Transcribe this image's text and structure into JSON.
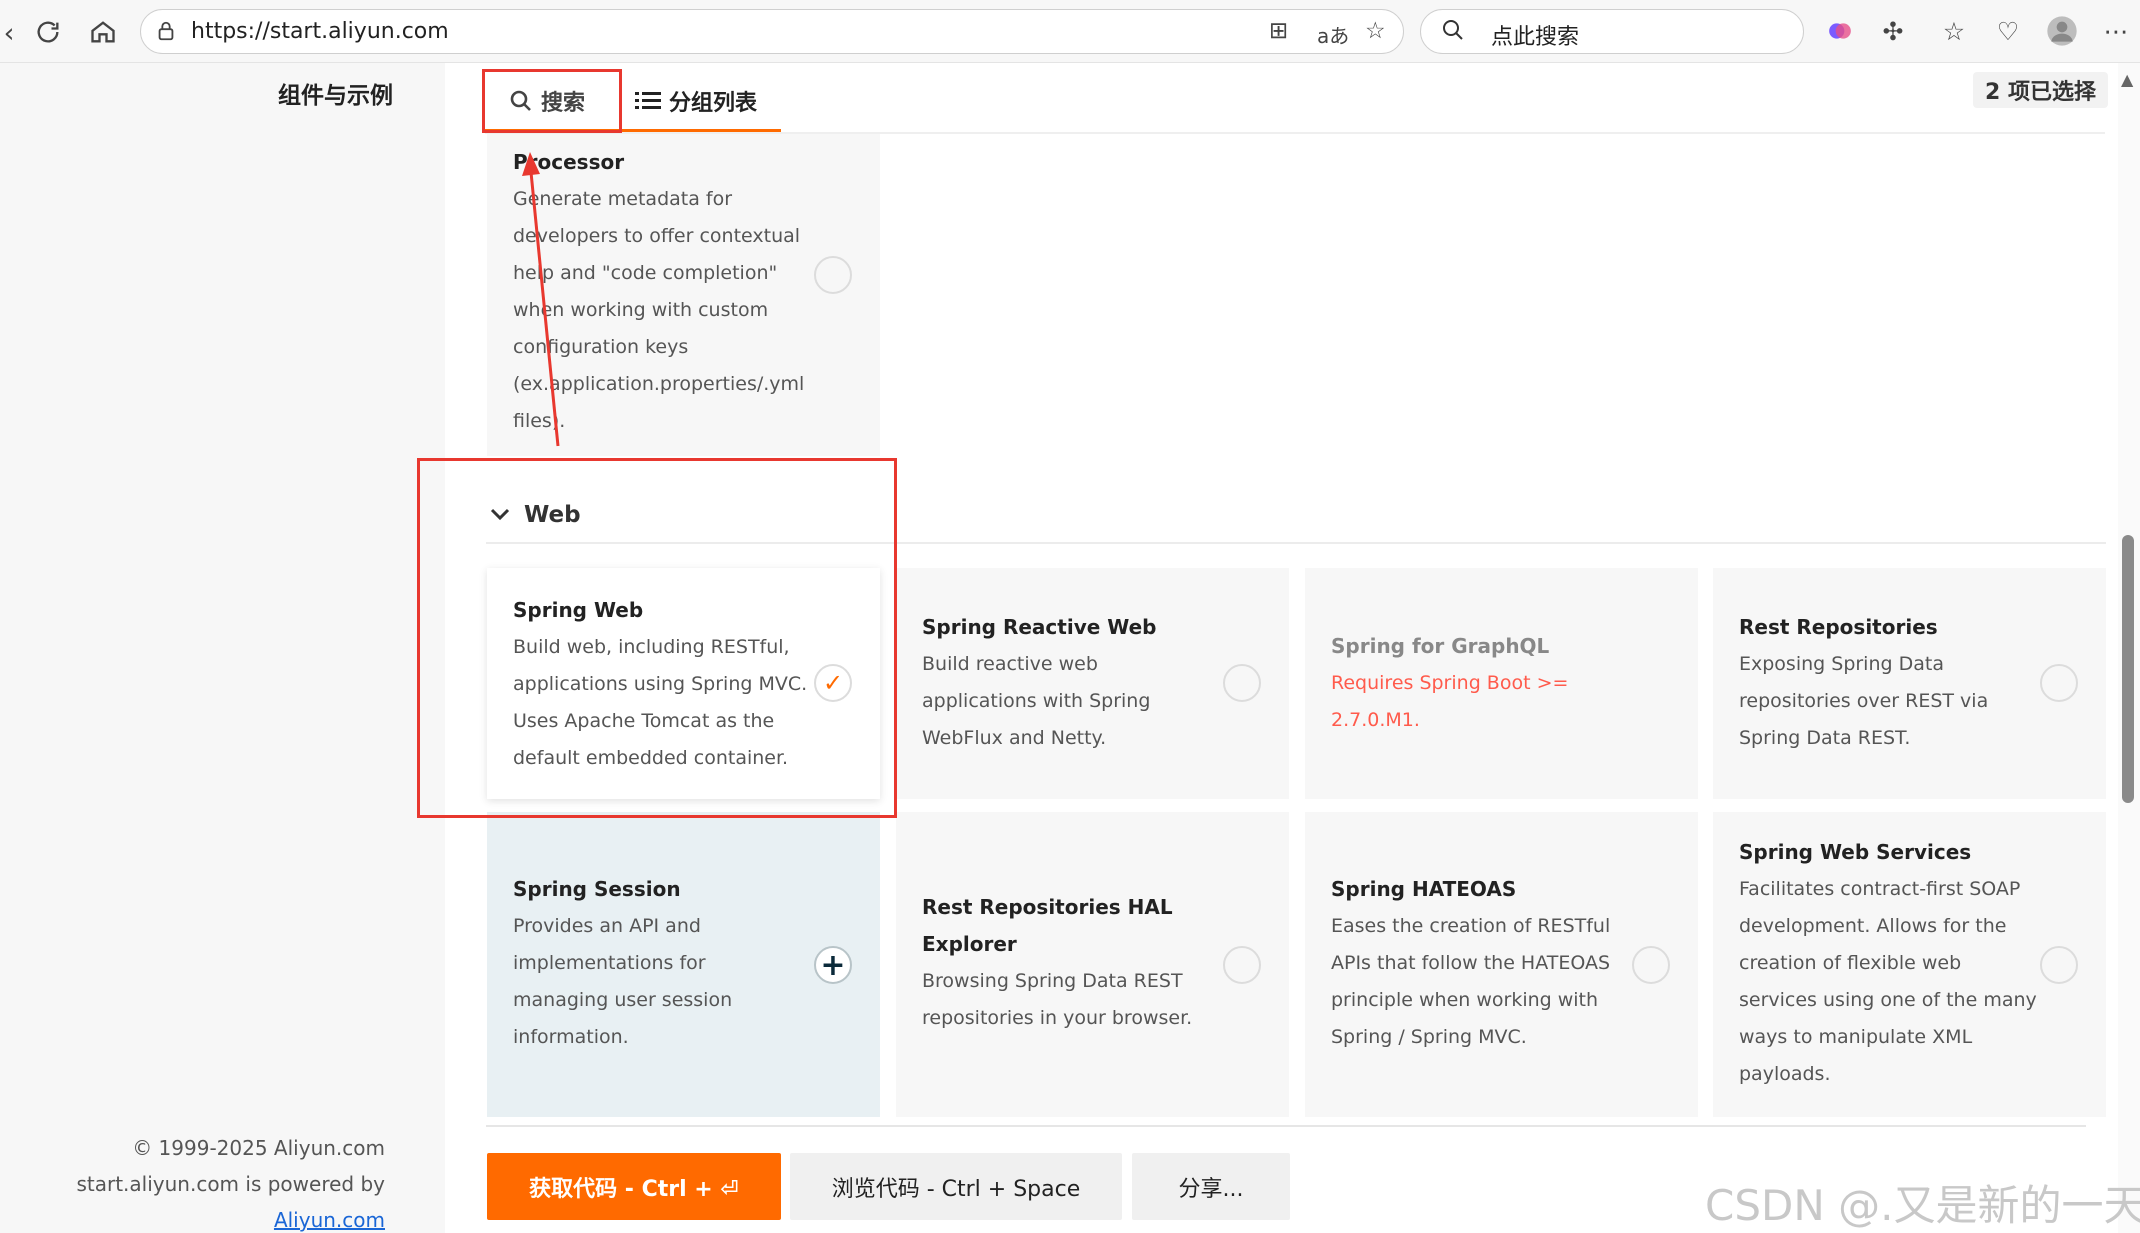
{
  "browser": {
    "url": "https://start.aliyun.com",
    "search_placeholder": "点此搜索",
    "icons": [
      "back-icon",
      "reload-icon",
      "home-icon",
      "lock-icon",
      "grid-icon",
      "translate-icon",
      "star-icon",
      "search-icon",
      "copilot-icon",
      "extensions-icon",
      "favorites-icon",
      "health-icon",
      "avatar-icon",
      "more-icon"
    ]
  },
  "sidebar": {
    "title": "组件与示例",
    "footer_copyright": "© 1999-2025 Aliyun.com",
    "footer_powered": "start.aliyun.com is powered by",
    "footer_link": "Aliyun.com"
  },
  "tabs": {
    "search_label": "搜索",
    "list_label": "分组列表"
  },
  "selected_count": "2 项已选择",
  "prev_card": {
    "title_tail": "Processor",
    "description_lines": [
      "Generate metadata for",
      "developers to offer contextual",
      "help and \"code completion\"",
      "when working with custom",
      "configuration keys",
      "(ex.application.properties/.yml",
      "files)."
    ]
  },
  "section": {
    "name": "Web",
    "chevron_icon": "chevron-down-icon"
  },
  "cards": [
    {
      "title_lines": [
        "Spring Web"
      ],
      "desc_lines": [
        "Build web, including RESTful,",
        "applications using Spring MVC.",
        "Uses Apache Tomcat as the",
        "default embedded container."
      ],
      "state": "selected"
    },
    {
      "title_lines": [
        "Spring Reactive Web"
      ],
      "desc_lines": [
        "Build reactive web",
        "applications with Spring",
        "WebFlux and Netty."
      ],
      "state": "unselected"
    },
    {
      "title_lines": [
        "Spring for GraphQL"
      ],
      "warn_lines": [
        "Requires Spring Boot >=",
        "2.7.0.M1."
      ],
      "state": "disabled"
    },
    {
      "title_lines": [
        "Rest Repositories"
      ],
      "desc_lines": [
        "Exposing Spring Data",
        "repositories over REST via",
        "Spring Data REST."
      ],
      "state": "unselected"
    },
    {
      "title_lines": [
        "Spring Session"
      ],
      "desc_lines": [
        "Provides an API and",
        "implementations for",
        "managing user session",
        "information."
      ],
      "state": "hover"
    },
    {
      "title_lines": [
        "Rest Repositories HAL",
        "Explorer"
      ],
      "desc_lines": [
        "Browsing Spring Data REST",
        "repositories in your browser."
      ],
      "state": "unselected"
    },
    {
      "title_lines": [
        "Spring HATEOAS"
      ],
      "desc_lines": [
        "Eases the creation of RESTful",
        "APIs that follow the HATEOAS",
        "principle when working with",
        "Spring / Spring MVC."
      ],
      "state": "unselected"
    },
    {
      "title_lines": [
        "Spring Web Services"
      ],
      "desc_lines": [
        "Facilitates contract-first SOAP",
        "development. Allows for the",
        "creation of flexible web",
        "services using one of the many",
        "ways to manipulate XML",
        "payloads."
      ],
      "state": "unselected"
    }
  ],
  "buttons": {
    "get_code": "获取代码 - Ctrl + ⏎",
    "browse_code": "浏览代码 - Ctrl + Space",
    "share": "分享..."
  },
  "watermark": "CSDN @.又是新的一天.",
  "colors": {
    "accent": "#ff6a00",
    "annotation": "#e8382f",
    "warning": "#ff5b4c"
  }
}
